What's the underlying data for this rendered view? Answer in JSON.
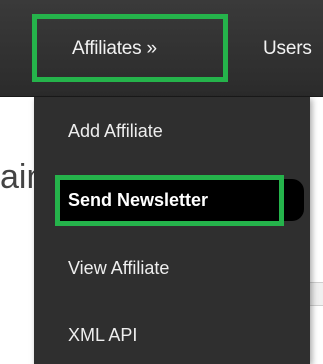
{
  "navbar": {
    "items": [
      {
        "label": "Affiliates »"
      },
      {
        "label": "Users"
      }
    ]
  },
  "page": {
    "heading_fragment": "ain"
  },
  "dropdown": {
    "items": [
      {
        "label": "Add Affiliate"
      },
      {
        "label": "Send Newsletter"
      },
      {
        "label": "View Affiliate"
      },
      {
        "label": "XML API"
      }
    ]
  },
  "colors": {
    "navbar_bg": "#2f2f2f",
    "dropdown_bg": "#2f2f2f",
    "highlight_outline": "#25b34b",
    "active_item_bg": "#000000"
  }
}
